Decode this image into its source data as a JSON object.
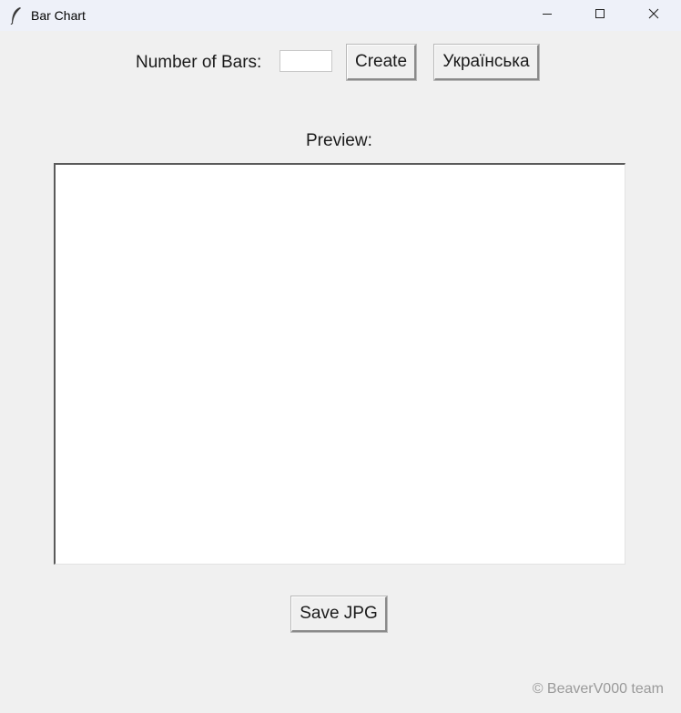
{
  "window": {
    "title": "Bar Chart",
    "app_icon": "feather-icon",
    "controls": [
      "minimize-icon",
      "maximize-icon",
      "close-icon"
    ]
  },
  "controls": {
    "bars_label": "Number of Bars:",
    "bars_input_value": "",
    "create_label": "Create",
    "language_label": "Українська"
  },
  "preview": {
    "label": "Preview:"
  },
  "save_label": "Save JPG",
  "credit": "© BeaverV000 team"
}
